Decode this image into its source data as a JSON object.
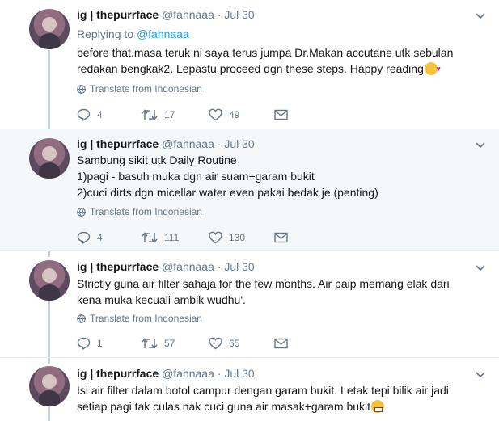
{
  "tweets": [
    {
      "display_name": "ig | thepurrface",
      "handle": "@fahnaaa",
      "date": "· Jul 30",
      "replying_prefix": "Replying to ",
      "replying_handle": "@fahnaaa",
      "lines": [
        "before that.masa teruk ni saya terus jumpa Dr.Makan accutane utk sebulan",
        "redakan bengkak2. Lepastu proceed dgn these steps. Happy reading"
      ],
      "translate": "Translate from Indonesian",
      "replies": "4",
      "retweets": "17",
      "likes": "49"
    },
    {
      "display_name": "ig | thepurrface",
      "handle": "@fahnaaa",
      "date": "· Jul 30",
      "lines": [
        "Sambung sikit utk Daily Routine",
        "1)pagi - basuh muka dgn air suam+garam bukit",
        "2)cuci dirts dgn micellar water even pakai bedak je (penting)"
      ],
      "translate": "Translate from Indonesian",
      "replies": "4",
      "retweets": "111",
      "likes": "130"
    },
    {
      "display_name": "ig | thepurrface",
      "handle": "@fahnaaa",
      "date": "· Jul 30",
      "lines": [
        "Strictly guna air filter sahaja for the few months. Air paip memang elak dari",
        "kena muka kecuali ambik wudhu'."
      ],
      "translate": "Translate from Indonesian",
      "replies": "1",
      "retweets": "57",
      "likes": "65"
    },
    {
      "display_name": "ig | thepurrface",
      "handle": "@fahnaaa",
      "date": "· Jul 30",
      "lines": [
        "Isi air filter dalam botol campur dengan garam bukit. Letak tepi bilik air jadi",
        "setiap pagi tak culas nak cuci guna air masak+garam bukit"
      ]
    }
  ],
  "icons": {
    "reply": "reply-icon",
    "retweet": "retweet-icon",
    "like": "heart-icon",
    "dm": "envelope-icon",
    "translate": "globe-icon",
    "caret": "chevron-down-icon"
  },
  "colors": {
    "link": "#1da1f2",
    "muted": "#657786",
    "highlight": "#f5f8fa",
    "thread_line": "#c4cfd6"
  }
}
